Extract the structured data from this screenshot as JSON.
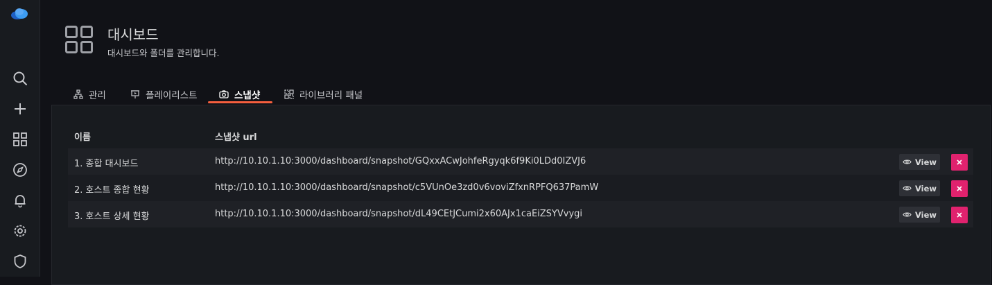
{
  "sidebar": {
    "icons": [
      "grafana-logo",
      "search-icon",
      "plus-icon",
      "dashboards-icon",
      "explore-icon",
      "alert-bell-icon",
      "gear-icon",
      "shield-icon"
    ]
  },
  "header": {
    "title": "대시보드",
    "subtitle": "대시보드와 폴더를 관리합니다."
  },
  "tabs": [
    {
      "label": "관리",
      "icon": "sitemap-icon",
      "active": false
    },
    {
      "label": "플레이리스트",
      "icon": "presentation-play-icon",
      "active": false
    },
    {
      "label": "스냅샷",
      "icon": "camera-icon",
      "active": true
    },
    {
      "label": "라이브러리 패널",
      "icon": "library-panel-icon",
      "active": false
    }
  ],
  "table": {
    "headers": {
      "name": "이름",
      "url": "스냅샷 url"
    },
    "view_label": "View",
    "rows": [
      {
        "name": "1. 종합 대시보드",
        "url": "http://10.10.1.10:3000/dashboard/snapshot/GQxxACwJohfeRgyqk6f9Ki0LDd0IZVJ6"
      },
      {
        "name": "2. 호스트 종합 현황",
        "url": "http://10.10.1.10:3000/dashboard/snapshot/c5VUnOe3zd0v6voviZfxnRPFQ637PamW"
      },
      {
        "name": "3. 호스트 상세 현황",
        "url": "http://10.10.1.10:3000/dashboard/snapshot/dL49CEtJCumi2x60AJx1caEiZSYVvygi"
      }
    ]
  },
  "colors": {
    "accent_tab": "#f55f3e",
    "delete": "#e0226e",
    "logo": "#3d9df2"
  }
}
